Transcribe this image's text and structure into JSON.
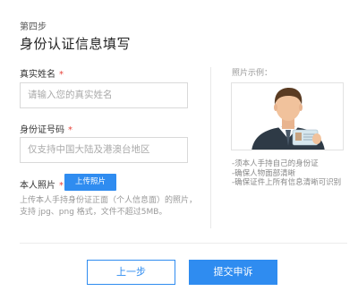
{
  "header": {
    "step": "第四步",
    "title": "身份认证信息填写"
  },
  "form": {
    "name_label": "真实姓名",
    "name_placeholder": "请输入您的真实姓名",
    "id_label": "身份证号码",
    "id_placeholder": "仅支持中国大陆及港澳台地区",
    "photo_label": "本人照片",
    "upload_button": "上传照片",
    "required_mark": "*",
    "hint_line1": "上传本人手持身份证正面（个人信息面）的照片，",
    "hint_line2": "支持 jpg、png 格式，文件不超过5MB。"
  },
  "sample": {
    "label": "照片示例：",
    "notes": [
      "-须本人手持自己的身份证",
      "-确保人物面部清晰",
      "-确保证件上所有信息清晰可识别"
    ]
  },
  "actions": {
    "prev": "上一步",
    "submit": "提交申诉"
  },
  "colors": {
    "accent": "#2f8cf0",
    "required": "#e8433a"
  }
}
